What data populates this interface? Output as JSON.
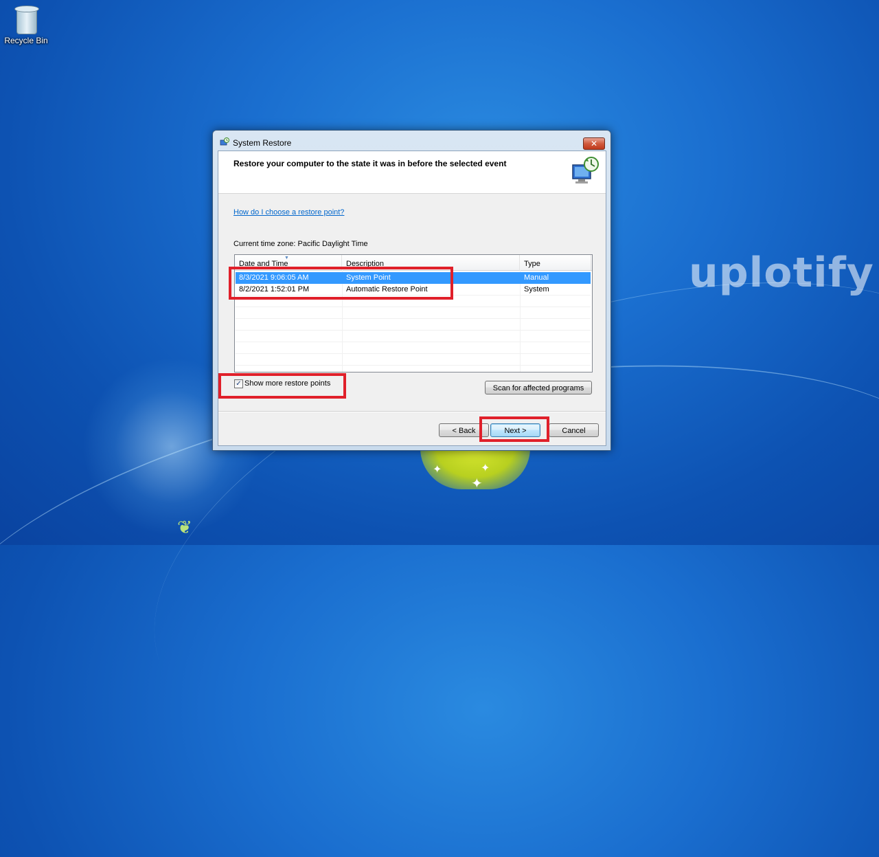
{
  "desktop": {
    "icons": [
      {
        "label": "Recycle Bin",
        "icon": "recycle-bin-icon"
      }
    ],
    "watermark": "uplotify"
  },
  "dialog": {
    "title": "System Restore",
    "header_title": "Restore your computer to the state it was in before the selected event",
    "help_link": "How do I choose a restore point?",
    "timezone_label": "Current time zone: Pacific Daylight Time",
    "table": {
      "columns": [
        "Date and Time",
        "Description",
        "Type"
      ],
      "rows": [
        {
          "date": "8/3/2021 9:06:05 AM",
          "description": "System Point",
          "type": "Manual",
          "selected": true
        },
        {
          "date": "8/2/2021 1:52:01 PM",
          "description": "Automatic Restore Point",
          "type": "System",
          "selected": false
        }
      ]
    },
    "show_more_label": "Show more restore points",
    "show_more_checked": true,
    "scan_button": "Scan for affected programs",
    "back_button": "< Back",
    "next_button": "Next >",
    "cancel_button": "Cancel",
    "close_glyph": "✕"
  },
  "colors": {
    "selection": "#3399ff",
    "link": "#0066cc",
    "annotation": "#e0202a"
  }
}
